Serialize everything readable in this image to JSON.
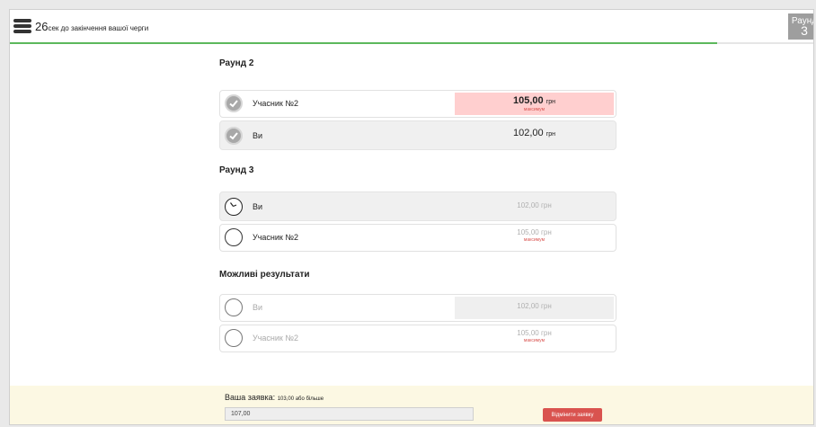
{
  "header": {
    "timer_value": "26",
    "timer_text": "сек до закінчення вашої черги",
    "progress_fraction": 0.88,
    "round_badge_label": "Раунд",
    "round_badge_number": "3"
  },
  "rounds": [
    {
      "title": "Раунд 2",
      "rows": [
        {
          "name": "Учасник №2",
          "amount": "105,00",
          "currency": "грн",
          "note": "максимум"
        },
        {
          "name": "Ви",
          "amount": "102,00",
          "currency": "грн",
          "note": ""
        }
      ]
    },
    {
      "title": "Раунд 3",
      "rows": [
        {
          "name": "Ви",
          "amount": "102,00",
          "currency": "грн",
          "note": ""
        },
        {
          "name": "Учасник №2",
          "amount": "105,00",
          "currency": "грн",
          "note": "максимум"
        }
      ]
    },
    {
      "title": "Можливі результати",
      "rows": [
        {
          "name": "Ви",
          "amount": "102,00",
          "currency": "грн",
          "note": ""
        },
        {
          "name": "Учасник №2",
          "amount": "105,00",
          "currency": "грн",
          "note": "максимум"
        }
      ]
    }
  ],
  "footer": {
    "bid_label": "Ваша заявка:",
    "bid_hint": "103,00 або більше",
    "bid_value": "107,00",
    "cancel_label": "Відмінити заявку"
  },
  "colors": {
    "progress": "#5cb85c",
    "highlight": "#ffcfcf",
    "danger": "#d9534f",
    "footer_bg": "#fcf8e3"
  },
  "icons": [
    "menu-icon",
    "check-icon",
    "clock-icon",
    "radio-empty-icon"
  ]
}
